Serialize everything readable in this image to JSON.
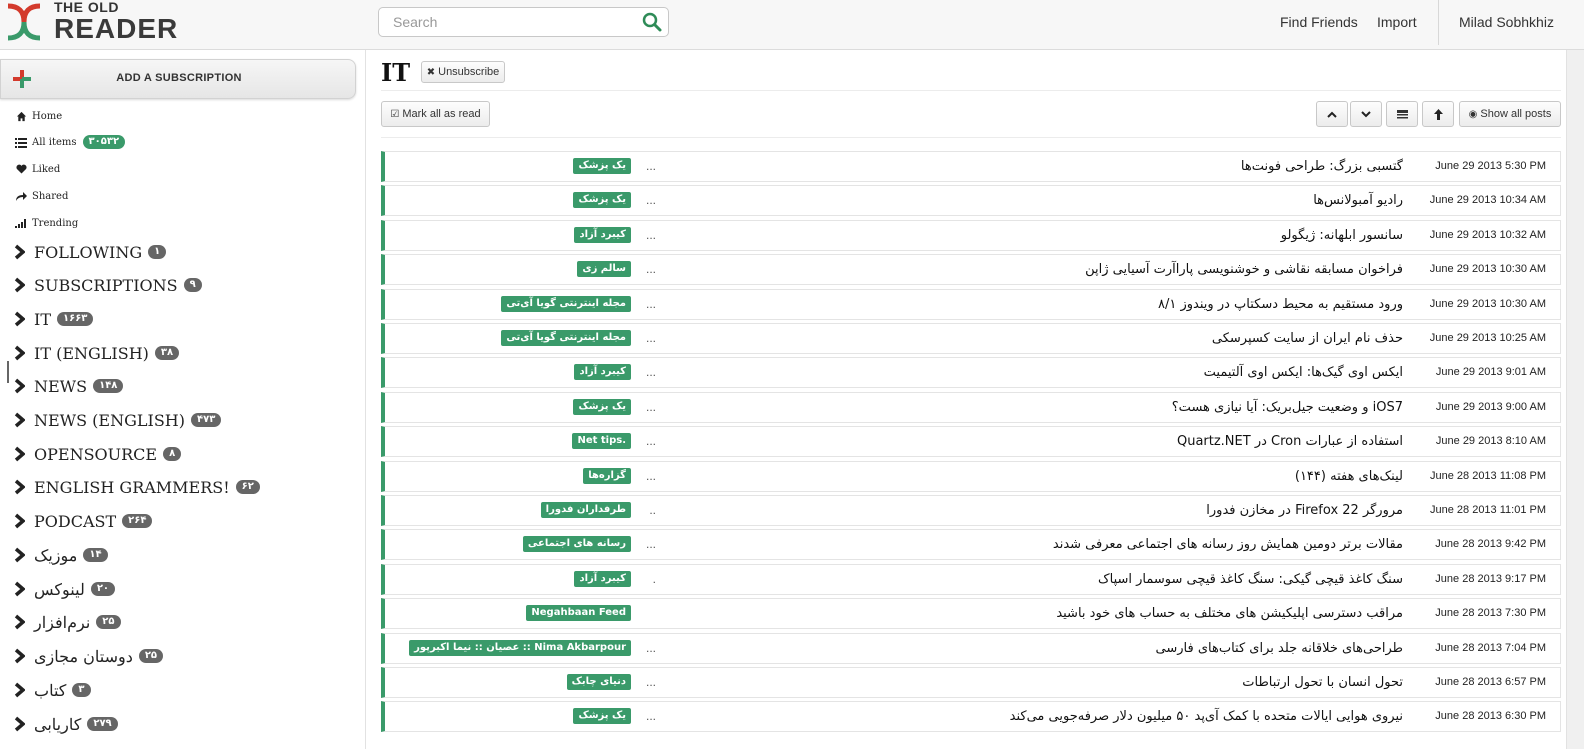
{
  "header": {
    "logo_small": "THE OLD",
    "logo_big": "READER",
    "search_placeholder": "Search",
    "find_friends": "Find Friends",
    "import": "Import",
    "user": "Milad Sobhkhiz"
  },
  "sidebar": {
    "add_subscription": "ADD A SUBSCRIPTION",
    "nav": [
      {
        "label": "Home",
        "icon": "home-icon"
      },
      {
        "label": "All items",
        "icon": "list-icon",
        "badge": "۳۰۵۳۲"
      },
      {
        "label": "Liked",
        "icon": "heart-icon"
      },
      {
        "label": "Shared",
        "icon": "share-icon"
      },
      {
        "label": "Trending",
        "icon": "signal-icon"
      }
    ],
    "folders": [
      {
        "label": "FOLLOWING",
        "badge": "۱"
      },
      {
        "label": "SUBSCRIPTIONS",
        "badge": "۹"
      },
      {
        "label": "IT",
        "badge": "۱۶۶۳"
      },
      {
        "label": "IT (ENGLISH)",
        "badge": "۳۸"
      },
      {
        "label": "NEWS",
        "badge": "۱۴۸"
      },
      {
        "label": "NEWS (ENGLISH)",
        "badge": "۴۷۳"
      },
      {
        "label": "OPENSOURCE",
        "badge": "۸"
      },
      {
        "label": "ENGLISH GRAMMERS!",
        "badge": "۶۲"
      },
      {
        "label": "PODCAST",
        "badge": "۲۶۴"
      },
      {
        "label": "موزیک",
        "badge": "۱۴"
      },
      {
        "label": "لینوکس",
        "badge": "۲۰"
      },
      {
        "label": "نرم‌افزار",
        "badge": "۲۵"
      },
      {
        "label": "دوستان مجازی",
        "badge": "۲۵"
      },
      {
        "label": "کتاب",
        "badge": "۳"
      },
      {
        "label": "کاریابی",
        "badge": "۲۷۹"
      }
    ]
  },
  "main": {
    "title": "IT",
    "unsubscribe": "Unsubscribe",
    "mark_all_read": "Mark all as read",
    "show_all_posts": "Show all posts",
    "posts": [
      {
        "tag": "یک پزشک",
        "title": "گتسبی بزرگ: طراحی فونت‌ها",
        "date": "June 29 2013 5:30 PM",
        "dots": "..."
      },
      {
        "tag": "یک پزشک",
        "title": "رادیو آمبولانس‌ها",
        "date": "June 29 2013 10:34 AM",
        "dots": "..."
      },
      {
        "tag": "کیبرد آزاد",
        "title": "سانسور ابلهانه: ژیگولو",
        "date": "June 29 2013 10:32 AM",
        "dots": "..."
      },
      {
        "tag": "سالم زی",
        "title": "فراخوان مسابقه نقاشی و خوشنویسی پاراآرت آسیایی ژاپن",
        "date": "June 29 2013 10:30 AM",
        "dots": "..."
      },
      {
        "tag": "مجله اینترنتی گویا آی‌تی",
        "title": "ورود مستقیم به محیط دسکتاپ در ویندوز ۸/۱",
        "date": "June 29 2013 10:30 AM",
        "dots": "..."
      },
      {
        "tag": "مجله اینترنتی گویا آی‌تی",
        "title": "حذف نام ایران از سایت کسپرسکی",
        "date": "June 29 2013 10:25 AM",
        "dots": "..."
      },
      {
        "tag": "کیبرد آزاد",
        "title": "ایکس اوی گیک‌ها: ایکس اوی آلتیمیت",
        "date": "June 29 2013 9:01 AM",
        "dots": "..."
      },
      {
        "tag": "یک پزشک",
        "title": "iOS7 و وضعیت جیل‌بریک: آیا نیازی هست؟",
        "date": "June 29 2013 9:00 AM",
        "dots": "..."
      },
      {
        "tag": "Net tips.",
        "title": "استفاده از عبارات Cron در Quartz.NET",
        "date": "June 29 2013 8:10 AM",
        "dots": "..."
      },
      {
        "tag": "گزاره‌ها",
        "title": "لینک‌های هفته (۱۴۴)",
        "date": "June 28 2013 11:08 PM",
        "dots": "..."
      },
      {
        "tag": "طرفداران فدورا",
        "title": "مرورگر Firefox 22 در مخازن فدورا",
        "date": "June 28 2013 11:01 PM",
        "dots": ".."
      },
      {
        "tag": "رسانه های اجتماعی",
        "title": "مقالات برتر دومین همایش روز رسانه های اجتماعی معرفی شدند",
        "date": "June 28 2013 9:42 PM",
        "dots": "..."
      },
      {
        "tag": "کیبرد آزاد",
        "title": "سنگ کاغذ قیچی گیکی: سنگ کاغذ قیچی سوسمار اسپاک",
        "date": "June 28 2013 9:17 PM",
        "dots": "."
      },
      {
        "tag": "Negahbaan Feed",
        "title": "مراقب دسترسی اپلیکیشن های مختلف به حساب های خود باشید",
        "date": "June 28 2013 7:30 PM",
        "dots": ""
      },
      {
        "tag": "عصیان :: نیما اکبرپور :: Nima Akbarpour",
        "title": "طراحی‌های خلاقانه جلد برای کتاب‌های فارسی",
        "date": "June 28 2013 7:04 PM",
        "dots": "..."
      },
      {
        "tag": "دنیای چابک",
        "title": "تحول انسان با تحول ارتباطات",
        "date": "June 28 2013 6:57 PM",
        "dots": "..."
      },
      {
        "tag": "یک پزشک",
        "title": "نیروی هوایی ایالات متحده با کمک آی‌پد ۵۰ میلیون دلار صرفه‌جویی می‌کند",
        "date": "June 28 2013 6:30 PM",
        "dots": "..."
      }
    ]
  },
  "colors": {
    "accent": "#3a9a6a",
    "badge": "#666666",
    "logo_red": "#d33a2c",
    "logo_green": "#3a9a6a"
  }
}
